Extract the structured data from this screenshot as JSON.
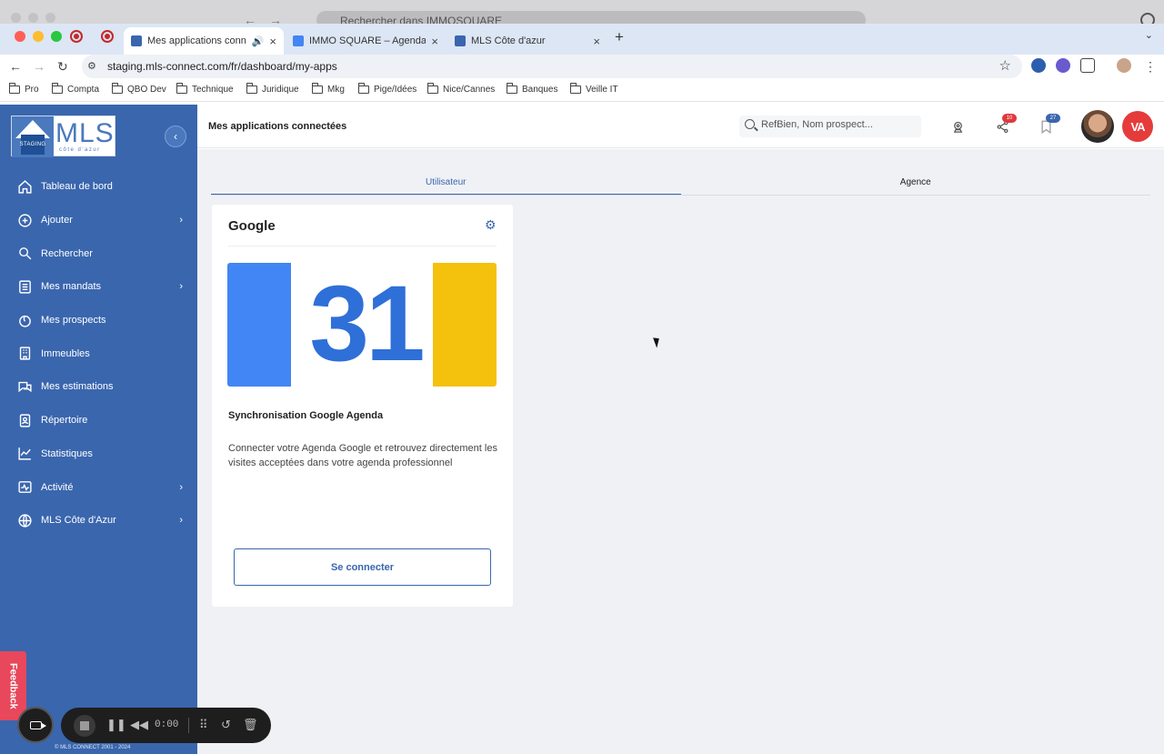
{
  "os": {
    "ghost_search_text": "Rechercher dans IMMOSQUARE"
  },
  "browser": {
    "tabs": [
      {
        "title": "Mes applications connec",
        "active": true,
        "fav_color": "#3a66ae"
      },
      {
        "title": "IMMO SQUARE – Agenda - S",
        "active": false,
        "fav_color": "#4285f4"
      },
      {
        "title": "MLS Côte d'azur",
        "active": false,
        "fav_color": "#3a66ae"
      }
    ],
    "new_tab": "+",
    "tab_close": "×",
    "url": "staging.mls-connect.com/fr/dashboard/my-apps",
    "bookmarks": [
      "Pro",
      "Compta",
      "QBO Dev",
      "Technique",
      "Juridique",
      "Mkg",
      "Pige/Idées",
      "Nice/Cannes",
      "Banques",
      "Veille IT"
    ]
  },
  "logo": {
    "brand": "MLS",
    "badge": "STAGING",
    "tagline": "côte d'azur"
  },
  "sidebar": {
    "items": [
      {
        "label": "Tableau de bord",
        "icon": "home-icon",
        "chevron": false
      },
      {
        "label": "Ajouter",
        "icon": "plus-circle-icon",
        "chevron": true
      },
      {
        "label": "Rechercher",
        "icon": "search-icon",
        "chevron": false
      },
      {
        "label": "Mes mandats",
        "icon": "list-icon",
        "chevron": true
      },
      {
        "label": "Mes prospects",
        "icon": "prospect-icon",
        "chevron": false
      },
      {
        "label": "Immeubles",
        "icon": "building-icon",
        "chevron": false
      },
      {
        "label": "Mes estimations",
        "icon": "chat-icon",
        "chevron": false
      },
      {
        "label": "Répertoire",
        "icon": "contact-book-icon",
        "chevron": false
      },
      {
        "label": "Statistiques",
        "icon": "chart-icon",
        "chevron": false
      },
      {
        "label": "Activité",
        "icon": "activity-icon",
        "chevron": true
      },
      {
        "label": "MLS Côte d'Azur",
        "icon": "globe-icon",
        "chevron": true
      }
    ],
    "copyright": "© MLS CONNECT 2001 - 2024"
  },
  "header": {
    "title": "Mes applications connectées",
    "search_placeholder": "RefBien, Nom prospect...",
    "share_badge": "10",
    "bookmark_badge": "27",
    "brand_initials": "VA"
  },
  "colors": {
    "primary": "#3a66ae",
    "badge_red": "#e0393e",
    "badge_blue": "#3a66ae",
    "feedback": "#e8475c"
  },
  "main": {
    "tabs": [
      {
        "label": "Utilisateur",
        "active": true
      },
      {
        "label": "Agence",
        "active": false
      }
    ],
    "card": {
      "title": "Google",
      "calendar_number": "31",
      "subtitle": "Synchronisation Google Agenda",
      "description": "Connecter votre Agenda Google et retrouvez directement les visites acceptées dans votre agenda professionnel",
      "button": "Se connecter"
    }
  },
  "overlay": {
    "feedback_label": "Feedback",
    "recorder_time": "0:00"
  }
}
